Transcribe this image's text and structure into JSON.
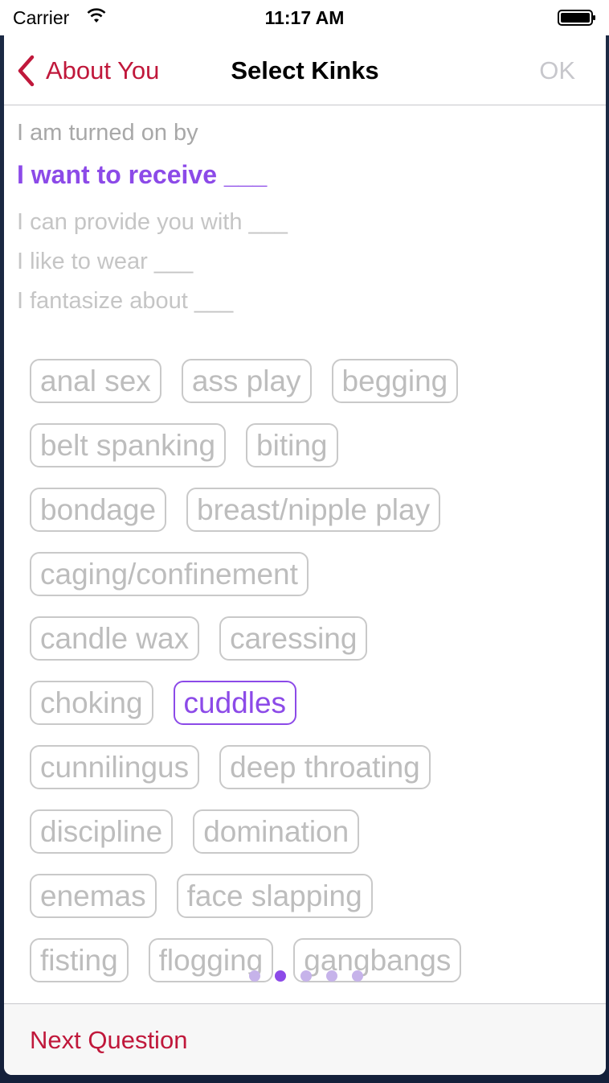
{
  "status": {
    "carrier": "Carrier",
    "time": "11:17 AM"
  },
  "nav": {
    "back_label": "About You",
    "title": "Select Kinks",
    "ok_label": "OK"
  },
  "prompts": [
    "I am turned on by",
    "I want to receive ___",
    "I can provide you with ___",
    "I like to wear ___",
    "I fantasize about ___"
  ],
  "active_prompt_index": 1,
  "tag_rows": [
    [
      "anal sex",
      "ass play",
      "begging"
    ],
    [
      "belt spanking",
      "biting"
    ],
    [
      "bondage",
      "breast/nipple play"
    ],
    [
      "caging/confinement"
    ],
    [
      "candle wax",
      "caressing"
    ],
    [
      "choking",
      "cuddles"
    ],
    [
      "cunnilingus",
      "deep throating"
    ],
    [
      "discipline",
      "domination"
    ],
    [
      "enemas",
      "face slapping"
    ],
    [
      "fisting",
      "flogging",
      "gangbangs"
    ]
  ],
  "selected_tags": [
    "cuddles"
  ],
  "page_indicator": {
    "pages": 5,
    "current": 2
  },
  "bottom": {
    "next_label": "Next Question"
  },
  "colors": {
    "accent": "#8c4ae8",
    "nav_tint": "#c0183b"
  }
}
